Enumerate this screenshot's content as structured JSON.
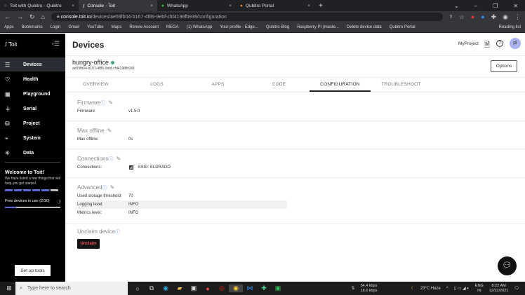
{
  "browser": {
    "tabs": [
      {
        "label": "Toit with Qubitro - Qubitro"
      },
      {
        "label": "Console - Toit"
      },
      {
        "label": "WhatsApp"
      },
      {
        "label": "Qubitro Portal"
      }
    ],
    "url_host": "console.toit.io",
    "url_path": "/devices/ae59fb04-b167-4f89-9ebf-cfd4198fb939/configuration",
    "bookmarks": [
      "Apps",
      "Bookmarks",
      "Login",
      "Gmail",
      "YouTube",
      "Maps",
      "Renew Account",
      "MEGA",
      "(1) WhatsApp",
      "Your profile - Edge...",
      "Qubitro Blog",
      "Raspberry Pi (maste...",
      "Delete device data",
      "Qubitro Portal",
      "Reading list"
    ]
  },
  "sidebar": {
    "logo": "Toit",
    "items": [
      {
        "label": "Devices",
        "icon": "devices-icon"
      },
      {
        "label": "Health",
        "icon": "health-icon"
      },
      {
        "label": "Playground",
        "icon": "playground-icon"
      },
      {
        "label": "Serial",
        "icon": "serial-icon"
      },
      {
        "label": "Project",
        "icon": "project-icon"
      },
      {
        "label": "System",
        "icon": "system-icon"
      },
      {
        "label": "Data",
        "icon": "data-icon"
      }
    ],
    "welcome_title": "Welcome to Toit!",
    "welcome_text": "We have listed a few things that will help you get started.",
    "steps_done": 5,
    "steps_total": 6,
    "free_devices": "Free devices in use (2/10)",
    "free_devices_fraction": 0.2,
    "setup_button": "Set up tools"
  },
  "header": {
    "title": "Devices",
    "project": "MyProject",
    "avatar": "pl"
  },
  "device": {
    "name": "hungry-office",
    "id": "ae59fb04-b167-4f89-9ebf-cfd4198fb939",
    "status_color": "#3ca38c",
    "options": "Options"
  },
  "tabs": [
    "OVERVIEW",
    "LOGS",
    "APPS",
    "CODE",
    "CONFIGURATION",
    "TROUBLESHOOT"
  ],
  "sections": {
    "firmware": {
      "title": "Firmware",
      "label": "Firmware:",
      "value": "v1.5.0"
    },
    "max_offline": {
      "title": "Max offline",
      "label": "Max offline:",
      "value": "0s"
    },
    "connections": {
      "title": "Connections",
      "label": "Connections:",
      "value": "SSID: ELDRADO"
    },
    "advanced": {
      "title": "Advanced",
      "rows": [
        {
          "label": "Used storage threshold:",
          "value": "70"
        },
        {
          "label": "Logging level:",
          "value": "INFO"
        },
        {
          "label": "Metrics level:",
          "value": "INFO"
        }
      ]
    },
    "unclaim": {
      "title": "Unclaim device",
      "button": "Unclaim"
    }
  },
  "taskbar": {
    "search": "Type here to search",
    "up": "54.4 kbps",
    "down": "18.6 kbps",
    "weather": "23°C  Haze",
    "lang1": "ENG",
    "lang2": "IN",
    "time": "8:22 AM",
    "date": "12/22/2021"
  }
}
